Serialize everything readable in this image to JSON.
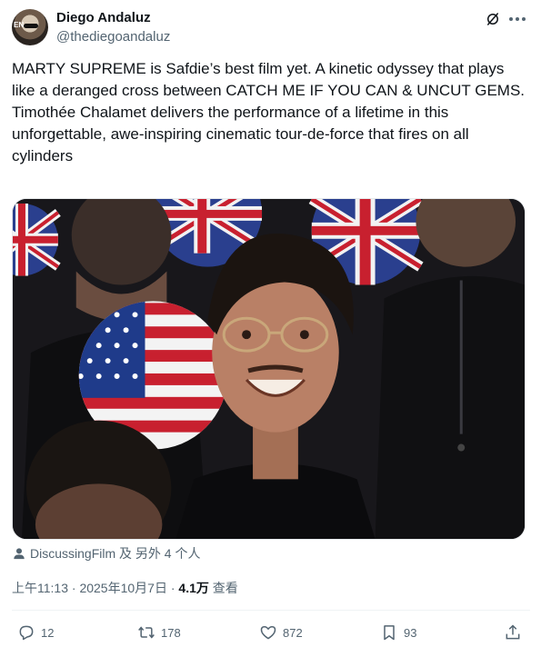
{
  "author": {
    "display_name": "Diego Andaluz",
    "handle": "@thediegoandaluz",
    "avatar_text": "EN"
  },
  "tweet": {
    "text": "MARTY SUPREME is Safdie’s best film yet. A kinetic odyssey that plays like a deranged cross between CATCH ME IF YOU CAN & UNCUT GEMS. Timothée Chalamet delivers the performance of a lifetime in this unforgettable, awe-inspiring cinematic tour-de-force that fires on all cylinders"
  },
  "media": {
    "icon": "photo"
  },
  "tagged": {
    "text": "DiscussingFilm 及 另外 4 个人",
    "icon": "person-icon"
  },
  "meta": {
    "time": "上午11:13",
    "separator": " · ",
    "date": "2025年10月7日",
    "views_count": "4.1万",
    "views_label": " 查看"
  },
  "actions": {
    "replies": "12",
    "retweets": "178",
    "likes": "872",
    "bookmarks": "93"
  },
  "colors": {
    "text": "#0f1419",
    "secondary": "#536471",
    "divider": "#eff3f4"
  }
}
